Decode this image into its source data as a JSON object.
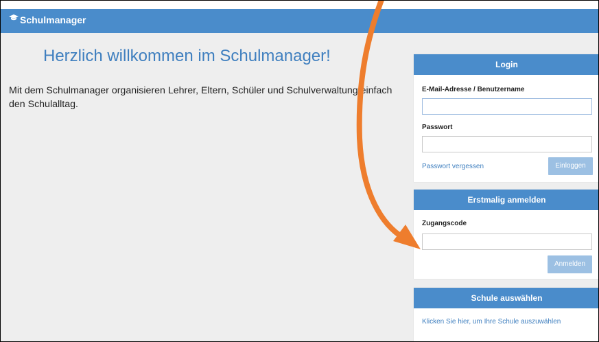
{
  "header": {
    "brand": "Schulmanager",
    "icon": "graduation-cap-icon"
  },
  "main": {
    "welcome_title": "Herzlich willkommen im Schulmanager!",
    "intro_text": "Mit dem Schulmanager organisieren Lehrer, Eltern, Schüler und Schulverwaltung einfach den Schulalltag."
  },
  "login": {
    "title": "Login",
    "email_label": "E-Mail-Adresse / Benutzername",
    "email_value": "",
    "password_label": "Passwort",
    "password_value": "",
    "forgot_link": "Passwort vergessen",
    "submit_label": "Einloggen"
  },
  "first_login": {
    "title": "Erstmalig anmelden",
    "code_label": "Zugangscode",
    "code_value": "",
    "submit_label": "Anmelden"
  },
  "school": {
    "title": "Schule auswählen",
    "link": "Klicken Sie hier, um Ihre Schule auszuwählen"
  },
  "colors": {
    "accent": "#4a8ccb",
    "button": "#9cc0e3",
    "annotation_arrow": "#ee7d2d"
  }
}
